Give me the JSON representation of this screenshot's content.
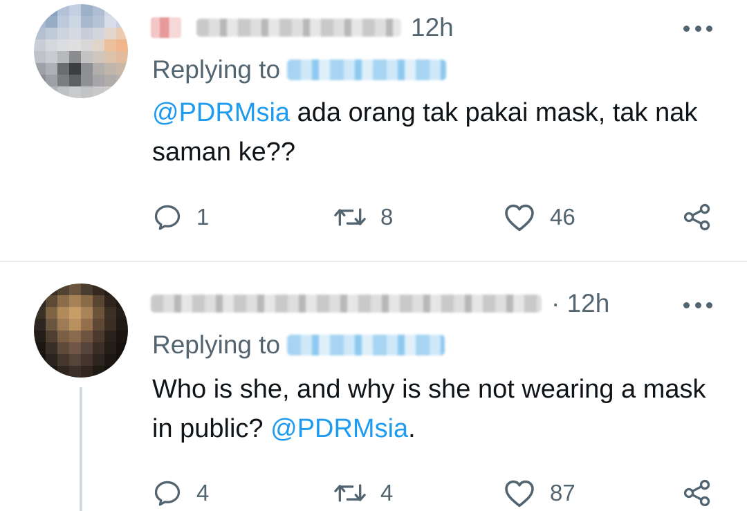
{
  "tweets": [
    {
      "time": "12h",
      "replying_label": "Replying to",
      "mention": "@PDRMsia",
      "text": " ada orang tak pakai mask, tak nak saman ke??",
      "replies": "1",
      "retweets": "8",
      "likes": "46"
    },
    {
      "time": "· 12h",
      "replying_label": "Replying to",
      "text_before": "Who is she, and why is she not wearing a mask in public? ",
      "mention": "@PDRMsia",
      "text_after": ".",
      "replies": "4",
      "retweets": "4",
      "likes": "87"
    }
  ],
  "icons": {
    "reply": "reply-icon",
    "retweet": "retweet-icon",
    "like": "heart-icon",
    "share": "share-icon",
    "more": "more-icon"
  },
  "colors": {
    "mention": "#1d9bf0",
    "secondary_text": "#536471",
    "primary_text": "#0f1419"
  }
}
